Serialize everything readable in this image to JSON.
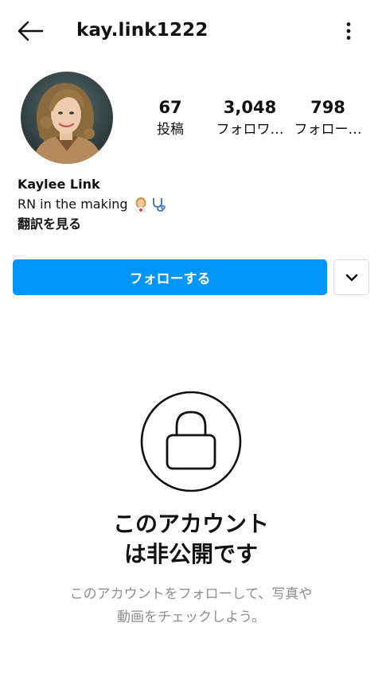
{
  "header": {
    "username": "kay.link1222",
    "back_icon": "arrow-left-icon",
    "more_icon": "more-vertical-icon"
  },
  "profile": {
    "stats": [
      {
        "value": "67",
        "label": "投稿"
      },
      {
        "value": "3,048",
        "label": "フォロワ…"
      },
      {
        "value": "798",
        "label": "フォロー…"
      }
    ],
    "name": "Kaylee Link",
    "bio": "RN in the making",
    "bio_icons": [
      "nurse-emoji-icon",
      "stethoscope-emoji-icon"
    ],
    "translate_label": "翻訳を見る"
  },
  "actions": {
    "follow_label": "フォローする",
    "dropdown_icon": "chevron-down-icon"
  },
  "private": {
    "lock_icon": "lock-icon",
    "title_line1": "このアカウント",
    "title_line2": "は非公開です",
    "description": "このアカウントをフォローして、写真や動画をチェックしよう。"
  },
  "colors": {
    "accent": "#0095f6",
    "muted_text": "#8e8e8e",
    "border": "#dbdbdb"
  }
}
